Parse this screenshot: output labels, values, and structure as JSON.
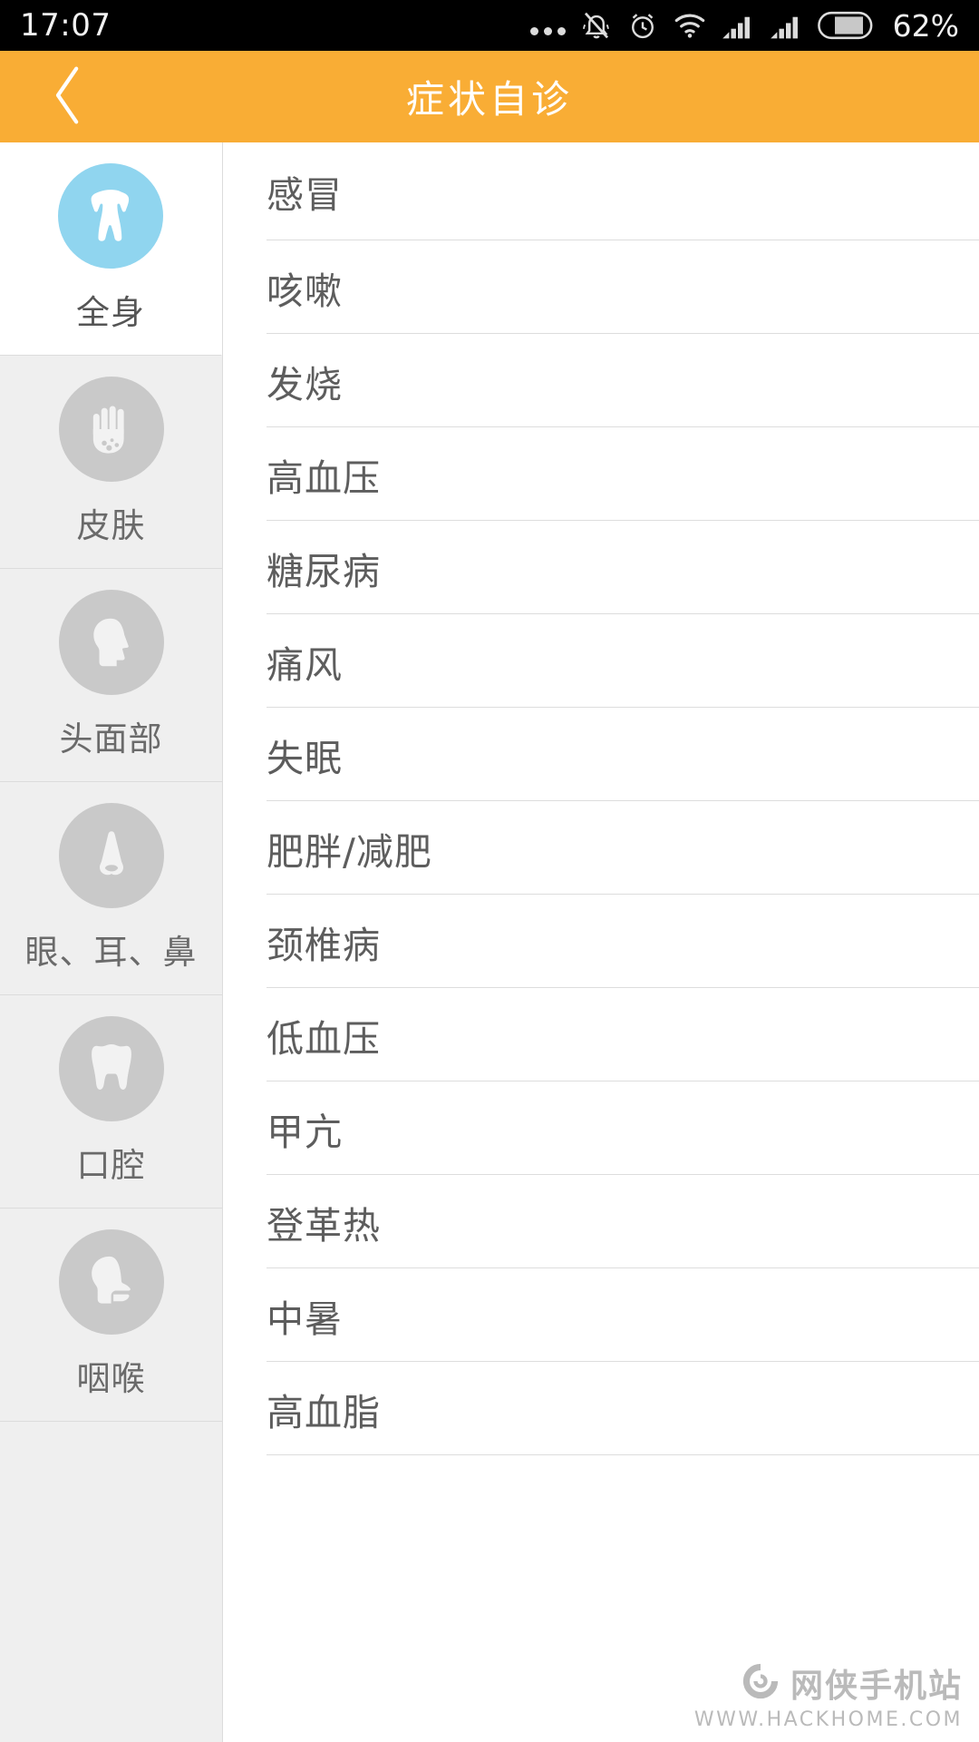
{
  "status_bar": {
    "time": "17:07",
    "battery_percent": "62%",
    "icons": [
      "more-dots-icon",
      "bell-muted-icon",
      "alarm-clock-icon",
      "wifi-icon",
      "signal-bars-icon",
      "signal-bars-icon",
      "battery-icon"
    ]
  },
  "header": {
    "title": "症状自诊",
    "back_icon": "chevron-left-icon",
    "background_color": "#f9ad35",
    "title_color": "#ffffff"
  },
  "sidebar": {
    "active_index": 0,
    "active_circle_color": "#90d5ef",
    "inactive_circle_color": "#c9c9c9",
    "items": [
      {
        "label": "全身",
        "icon": "torso-body-icon",
        "active": true
      },
      {
        "label": "皮肤",
        "icon": "hand-skin-icon",
        "active": false
      },
      {
        "label": "头面部",
        "icon": "head-face-icon",
        "active": false
      },
      {
        "label": "眼、耳、鼻",
        "icon": "nose-icon",
        "active": false
      },
      {
        "label": "口腔",
        "icon": "tooth-icon",
        "active": false
      },
      {
        "label": "咽喉",
        "icon": "throat-icon",
        "active": false
      }
    ]
  },
  "list": {
    "items": [
      {
        "label": "感冒"
      },
      {
        "label": "咳嗽"
      },
      {
        "label": "发烧"
      },
      {
        "label": "高血压"
      },
      {
        "label": "糖尿病"
      },
      {
        "label": "痛风"
      },
      {
        "label": "失眠"
      },
      {
        "label": "肥胖/减肥"
      },
      {
        "label": "颈椎病"
      },
      {
        "label": "低血压"
      },
      {
        "label": "甲亢"
      },
      {
        "label": "登革热"
      },
      {
        "label": "中暑"
      },
      {
        "label": "高血脂"
      }
    ]
  },
  "watermark": {
    "name": "网侠手机站",
    "url": "WWW.HACKHOME.COM",
    "logo_icon": "circle-swirl-logo-icon"
  }
}
